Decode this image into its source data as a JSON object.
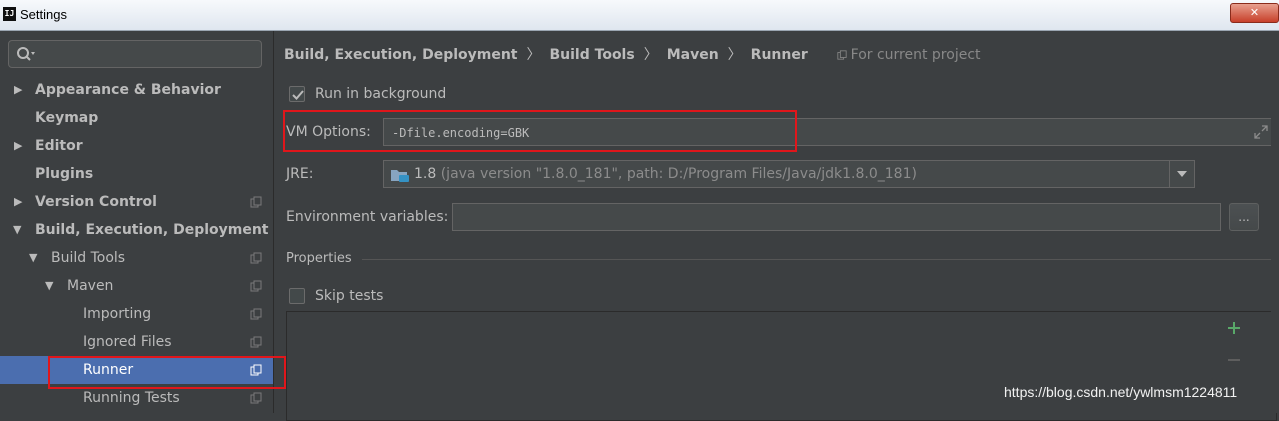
{
  "window": {
    "title": "Settings",
    "close_label": "✕"
  },
  "sidebar": {
    "search": {
      "value": "",
      "placeholder": ""
    },
    "items": [
      {
        "label": "Appearance & Behavior",
        "expanded": false,
        "bold": true
      },
      {
        "label": "Keymap",
        "bold": true
      },
      {
        "label": "Editor",
        "expanded": false,
        "bold": true
      },
      {
        "label": "Plugins",
        "bold": true
      },
      {
        "label": "Version Control",
        "expanded": false,
        "bold": true
      },
      {
        "label": "Build, Execution, Deployment",
        "expanded": true,
        "bold": true
      },
      {
        "label": "Build Tools",
        "expanded": true
      },
      {
        "label": "Maven",
        "expanded": true
      },
      {
        "label": "Importing"
      },
      {
        "label": "Ignored Files"
      },
      {
        "label": "Runner",
        "selected": true
      },
      {
        "label": "Running Tests"
      }
    ]
  },
  "breadcrumb": {
    "parts": [
      "Build, Execution, Deployment",
      "Build Tools",
      "Maven",
      "Runner"
    ],
    "separator": "〉",
    "scope": "For current project"
  },
  "runner": {
    "run_in_background": {
      "label": "Run in background",
      "checked": true
    },
    "vm_options": {
      "label": "VM Options:",
      "value": "-Dfile.encoding=GBK"
    },
    "jre": {
      "label": "JRE:",
      "version": "1.8",
      "detail": "(java version \"1.8.0_181\", path: D:/Program Files/Java/jdk1.8.0_181)"
    },
    "env": {
      "label": "Environment variables:",
      "value": "",
      "button": "..."
    },
    "properties": {
      "title": "Properties"
    },
    "skip_tests": {
      "label": "Skip tests",
      "checked": false
    }
  },
  "watermark": "https://blog.csdn.net/ywlmsm1224811",
  "colors": {
    "selection": "#4b6eaf",
    "highlight": "#e0161b",
    "add": "#59a869"
  }
}
